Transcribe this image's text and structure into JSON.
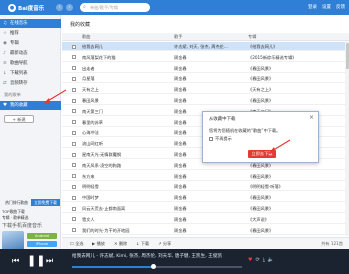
{
  "app": {
    "logo_text": "Bai度音乐",
    "back_icon": "‹",
    "forward_icon": "›",
    "search_placeholder": "单曲/歌手/专辑",
    "top_right": [
      "登录",
      "设置",
      "反馈"
    ]
  },
  "sidebar": {
    "items": [
      {
        "label": "在线音乐",
        "icon": "music-icon",
        "glyph": "♫",
        "active": true
      },
      {
        "label": "推荐",
        "icon": "star-icon",
        "glyph": "☆",
        "active": false
      },
      {
        "label": "专辑",
        "icon": "disc-icon",
        "glyph": "◉",
        "active": false
      },
      {
        "label": "最新动态",
        "icon": "bell-icon",
        "glyph": "♪",
        "active": false
      },
      {
        "label": "歌曲导航",
        "icon": "list-icon",
        "glyph": "≡",
        "active": false
      },
      {
        "label": "下载列表",
        "icon": "download-icon",
        "glyph": "↓",
        "active": false
      },
      {
        "label": "音频转存",
        "icon": "transfer-icon",
        "glyph": "⇄",
        "active": false
      }
    ],
    "section_label": "我的歌单",
    "playlist_item": {
      "label": "我的收藏",
      "icon": "heart-icon",
      "glyph": "♥",
      "active": true
    },
    "new_list_label": "+ 新建"
  },
  "promo": {
    "tabs": [
      "热门排行歌曲",
      "立即免费下载"
    ],
    "lines": [
      "TOP歌曲下载",
      "专辑 · 歌单精选"
    ],
    "title": "下载手机百度音乐",
    "buttons": [
      {
        "label": "Android",
        "color": "#7cb342"
      },
      {
        "label": "iPhone",
        "color": "#42a5f5"
      },
      {
        "label": "iPad",
        "color": "#ef6c00"
      }
    ]
  },
  "main": {
    "title": "我的收藏",
    "columns": {
      "song": "歌曲",
      "artist": "歌手",
      "album": "专辑"
    },
    "rows": [
      {
        "song": "给我去网儿",
        "artist": "许志斌, 刘天, 张杰, 周杰伦...",
        "album": "《给我去网儿》",
        "selected": true
      },
      {
        "song": "南风落梨花下的猫",
        "artist": "周金春",
        "album": "《2015新综乐精选专辑》",
        "selected": false
      },
      {
        "song": "出走者",
        "artist": "周金春",
        "album": "《春田风景》",
        "selected": false
      },
      {
        "song": "月星落",
        "artist": "周金春",
        "album": "《春田风景》",
        "selected": false
      },
      {
        "song": "天有之上",
        "artist": "周金春",
        "album": "《天有之上》",
        "selected": false
      },
      {
        "song": "春田风景",
        "artist": "周金春",
        "album": "《春田风景》",
        "selected": false
      },
      {
        "song": "南天第三门",
        "artist": "周金春",
        "album": "《南天二门》",
        "selected": false
      },
      {
        "song": "春里的苏草",
        "artist": "周金春",
        "album": "《春田风景》",
        "selected": false
      },
      {
        "song": "心海冲法",
        "artist": "周金春",
        "album": "《春田风景》",
        "selected": false
      },
      {
        "song": "流山网红听",
        "artist": "周金春",
        "album": "《春田风景》",
        "selected": false
      },
      {
        "song": "星南天光·无情群魔钢",
        "artist": "周金春",
        "album": "《春田风景》",
        "selected": false
      },
      {
        "song": "南天风系·凌空的狗路",
        "artist": "周金春",
        "album": "《春田风景》",
        "selected": false
      },
      {
        "song": "东方来",
        "artist": "周金春",
        "album": "《春田风景》",
        "selected": false
      },
      {
        "song": "明明轻雪",
        "artist": "周金春",
        "album": "《明明轻雪·听落》",
        "selected": false
      },
      {
        "song": "中国时梦",
        "artist": "周金春",
        "album": "《春田风景》",
        "selected": false
      },
      {
        "song": "风云天荒去·止都南面离",
        "artist": "周金春",
        "album": "《春田风景》",
        "selected": false
      },
      {
        "song": "雪文人",
        "artist": "周金春",
        "album": "《大声说》",
        "selected": false
      },
      {
        "song": "我们的时光·为干的开地园",
        "artist": "周金春",
        "album": "《春田风景》",
        "selected": false
      }
    ],
    "toolbar": [
      {
        "label": "全选",
        "icon": "checkbox-icon",
        "glyph": "☐"
      },
      {
        "label": "播放",
        "icon": "play-icon",
        "glyph": "▶"
      },
      {
        "label": "删除",
        "icon": "delete-icon",
        "glyph": "✕"
      },
      {
        "label": "下载",
        "icon": "download-icon",
        "glyph": "↓"
      },
      {
        "label": "分享",
        "icon": "share-icon",
        "glyph": "↗"
      }
    ],
    "count_text": "共有 121首"
  },
  "dialog": {
    "title": "从收藏中下载",
    "close_glyph": "×",
    "message": "您将为您随机在收藏的“歌曲”中下载。",
    "checkbox_label": "不再提示",
    "button_label": "立即去下载"
  },
  "player": {
    "now_playing": "给我去网儿 - 许志斌, Kimi, 张杰, 周杰伦, 刘天华, 唐子健, 王凯生, 王俊凯",
    "time": "00:42",
    "progress": 0.48,
    "accent": "#2f7fd6"
  },
  "annotation_color": "#e53935"
}
